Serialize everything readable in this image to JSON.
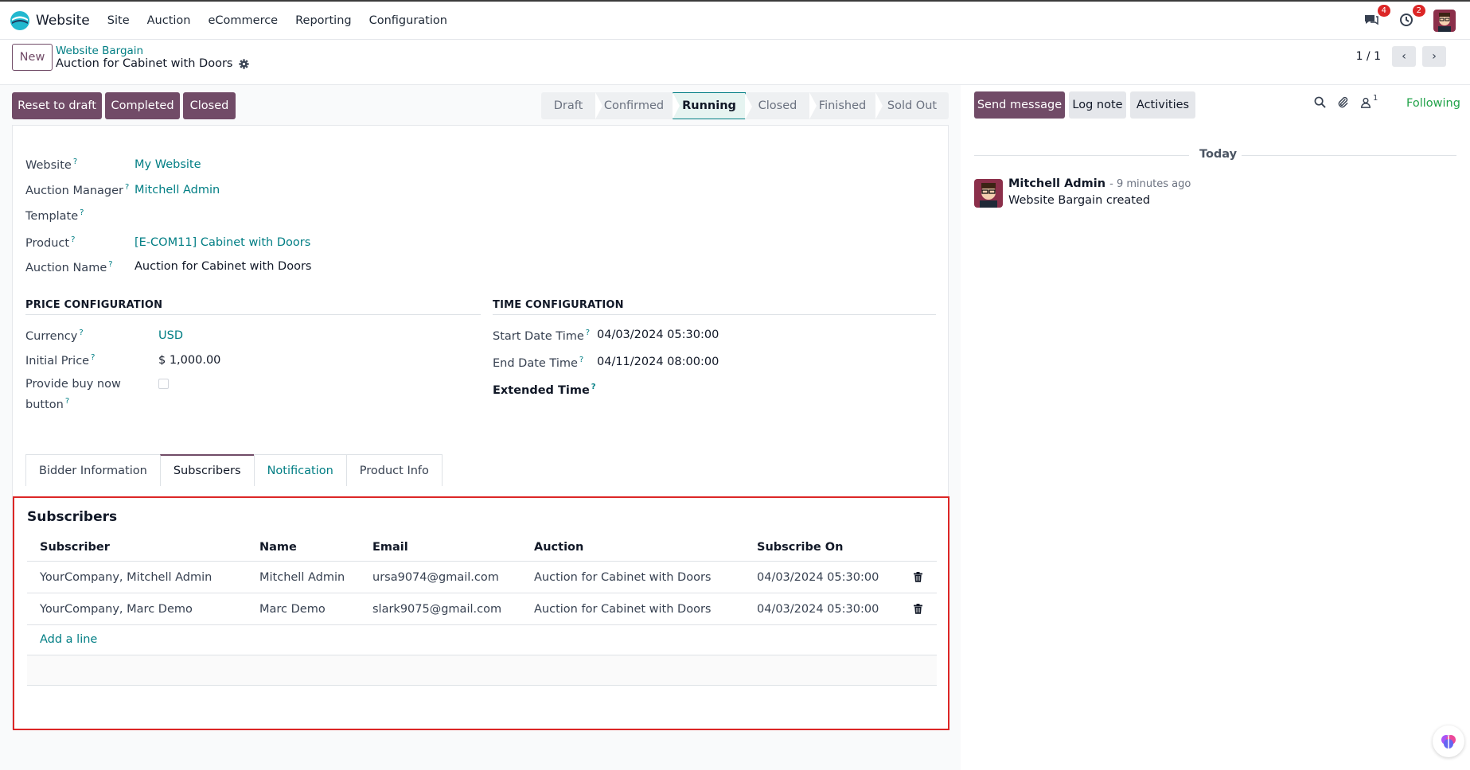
{
  "navbar": {
    "app_name": "Website",
    "menu": [
      "Site",
      "Auction",
      "eCommerce",
      "Reporting",
      "Configuration"
    ],
    "messages_badge": "4",
    "activities_badge": "2"
  },
  "control": {
    "new_label": "New",
    "breadcrumb_parent": "Website Bargain",
    "breadcrumb_current": "Auction for Cabinet with Doors",
    "pager": "1 / 1"
  },
  "actions": {
    "reset": "Reset to draft",
    "completed": "Completed",
    "closed": "Closed"
  },
  "stages": [
    "Draft",
    "Confirmed",
    "Running",
    "Closed",
    "Finished",
    "Sold Out"
  ],
  "active_stage": "Running",
  "fields": {
    "website_label": "Website",
    "website_value": "My Website",
    "manager_label": "Auction Manager",
    "manager_value": "Mitchell Admin",
    "template_label": "Template",
    "product_label": "Product",
    "product_value": "[E-COM11] Cabinet with Doors",
    "auction_name_label": "Auction Name",
    "auction_name_value": "Auction for Cabinet with Doors"
  },
  "price": {
    "title": "PRICE CONFIGURATION",
    "currency_label": "Currency",
    "currency_value": "USD",
    "initial_label": "Initial Price",
    "initial_value": "$ 1,000.00",
    "buy_now_label_1": "Provide buy now",
    "buy_now_label_2": "button",
    "buy_now_checked": false
  },
  "time": {
    "title": "TIME CONFIGURATION",
    "start_label": "Start Date Time",
    "start_value": "04/03/2024 05:30:00",
    "end_label": "End Date Time",
    "end_value": "04/11/2024 08:00:00",
    "extended_label": "Extended Time"
  },
  "tabs": [
    "Bidder Information",
    "Subscribers",
    "Notification",
    "Product Info"
  ],
  "active_tab": "Subscribers",
  "subscribers": {
    "title": "Subscribers",
    "columns": [
      "Subscriber",
      "Name",
      "Email",
      "Auction",
      "Subscribe On"
    ],
    "rows": [
      [
        "YourCompany, Mitchell Admin",
        "Mitchell Admin",
        "ursa9074@gmail.com",
        "Auction for Cabinet with Doors",
        "04/03/2024 05:30:00"
      ],
      [
        "YourCompany, Marc Demo",
        "Marc Demo",
        "slark9075@gmail.com",
        "Auction for Cabinet with Doors",
        "04/03/2024 05:30:00"
      ]
    ],
    "add_line": "Add a line"
  },
  "chatter": {
    "send_message": "Send message",
    "log_note": "Log note",
    "activities": "Activities",
    "followers_count": "1",
    "following": "Following",
    "today": "Today",
    "message": {
      "author": "Mitchell Admin",
      "time": "- 9 minutes ago",
      "body": "Website Bargain created"
    }
  },
  "colors": {
    "brand": "#714b67",
    "link": "#017e84",
    "highlight_border": "#dc2626",
    "following": "#22a34a"
  }
}
